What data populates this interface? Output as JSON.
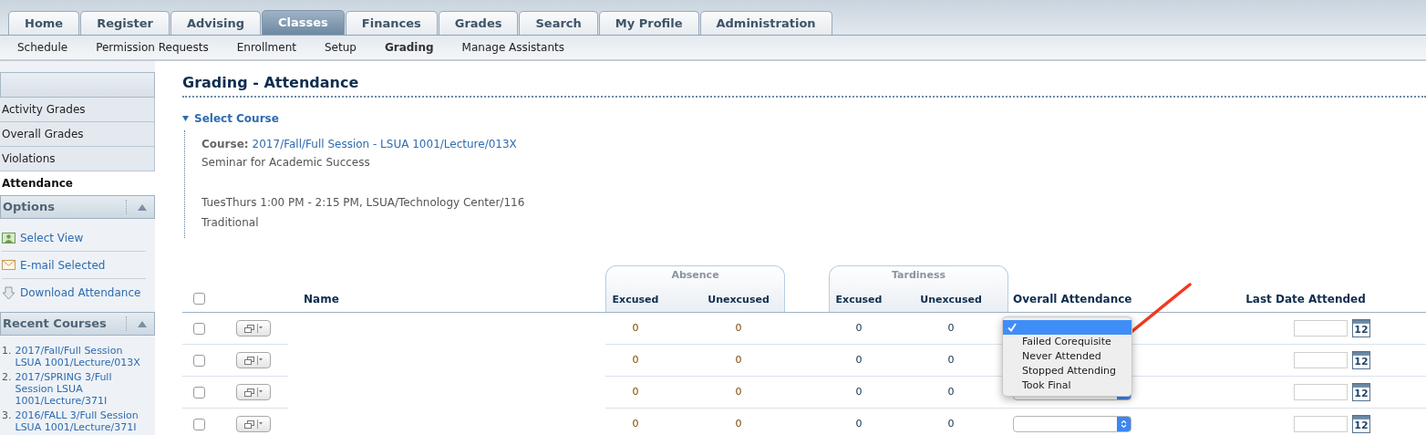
{
  "tabs": [
    {
      "label": "Home",
      "selected": false
    },
    {
      "label": "Register",
      "selected": false
    },
    {
      "label": "Advising",
      "selected": false
    },
    {
      "label": "Classes",
      "selected": true
    },
    {
      "label": "Finances",
      "selected": false
    },
    {
      "label": "Grades",
      "selected": false
    },
    {
      "label": "Search",
      "selected": false
    },
    {
      "label": "My Profile",
      "selected": false
    },
    {
      "label": "Administration",
      "selected": false
    }
  ],
  "subnav": [
    {
      "label": "Schedule",
      "selected": false
    },
    {
      "label": "Permission Requests",
      "selected": false
    },
    {
      "label": "Enrollment",
      "selected": false
    },
    {
      "label": "Setup",
      "selected": false
    },
    {
      "label": "Grading",
      "selected": true
    },
    {
      "label": "Manage Assistants",
      "selected": false
    }
  ],
  "sidebar": {
    "items": [
      {
        "label": "Activity Grades",
        "selected": false
      },
      {
        "label": "Overall Grades",
        "selected": false
      },
      {
        "label": "Violations",
        "selected": false
      },
      {
        "label": "Attendance",
        "selected": true
      }
    ],
    "options": {
      "title": "Options",
      "expanded": true,
      "items": [
        {
          "kind": "person",
          "label": "Select View"
        },
        {
          "kind": "mail",
          "label": "E-mail Selected"
        },
        {
          "kind": "download",
          "label": "Download Attendance"
        }
      ]
    },
    "recent_courses": {
      "title": "Recent Courses",
      "expanded": true,
      "items": [
        {
          "number": "1.",
          "label": "2017/Fall/Full Session LSUA 1001/Lecture/013X"
        },
        {
          "number": "2.",
          "label": "2017/SPRING 3/Full Session LSUA 1001/Lecture/371I"
        },
        {
          "number": "3.",
          "label": "2016/FALL 3/Full Session LSUA 1001/Lecture/371I"
        }
      ]
    }
  },
  "main": {
    "title": "Grading - Attendance",
    "select_course": {
      "title": "Select Course",
      "expanded": true,
      "course_label": "Course:",
      "course": "2017/Fall/Full Session - LSUA 1001/Lecture/013X",
      "name": "Seminar for Academic Success",
      "schedule": "TuesThurs 1:00 PM - 2:15 PM, LSUA/Technology Center/116",
      "type": "Traditional"
    },
    "table": {
      "select_all_checked": false,
      "groups": [
        {
          "title": "Absence"
        },
        {
          "title": "Tardiness"
        }
      ],
      "columns": {
        "name": "Name",
        "absence_excused": "Excused",
        "absence_unexcused": "Unexcused",
        "tardiness_excused": "Excused",
        "tardiness_unexcused": "Unexcused",
        "overall": "Overall Attendance",
        "last_date": "Last Date Attended"
      },
      "rows": [
        {
          "checked": false,
          "absence_excused": "0",
          "absence_unexcused": "0",
          "tardiness_excused": "0",
          "tardiness_unexcused": "0",
          "calendar": "12",
          "menu_open": true
        },
        {
          "checked": false,
          "absence_excused": "0",
          "absence_unexcused": "0",
          "tardiness_excused": "0",
          "tardiness_unexcused": "0",
          "calendar": "12",
          "menu_open": false
        },
        {
          "checked": false,
          "absence_excused": "0",
          "absence_unexcused": "0",
          "tardiness_excused": "0",
          "tardiness_unexcused": "0",
          "calendar": "12",
          "menu_open": false
        },
        {
          "checked": false,
          "absence_excused": "0",
          "absence_unexcused": "0",
          "tardiness_excused": "0",
          "tardiness_unexcused": "0",
          "calendar": "12",
          "menu_open": false
        }
      ],
      "open_menu": {
        "options": [
          {
            "selected": true
          },
          {
            "label": "Failed Corequisite",
            "selected": false
          },
          {
            "label": "Never Attended",
            "selected": false
          },
          {
            "label": "Stopped Attending",
            "selected": false
          },
          {
            "label": "Took Final",
            "selected": false
          }
        ]
      }
    }
  }
}
